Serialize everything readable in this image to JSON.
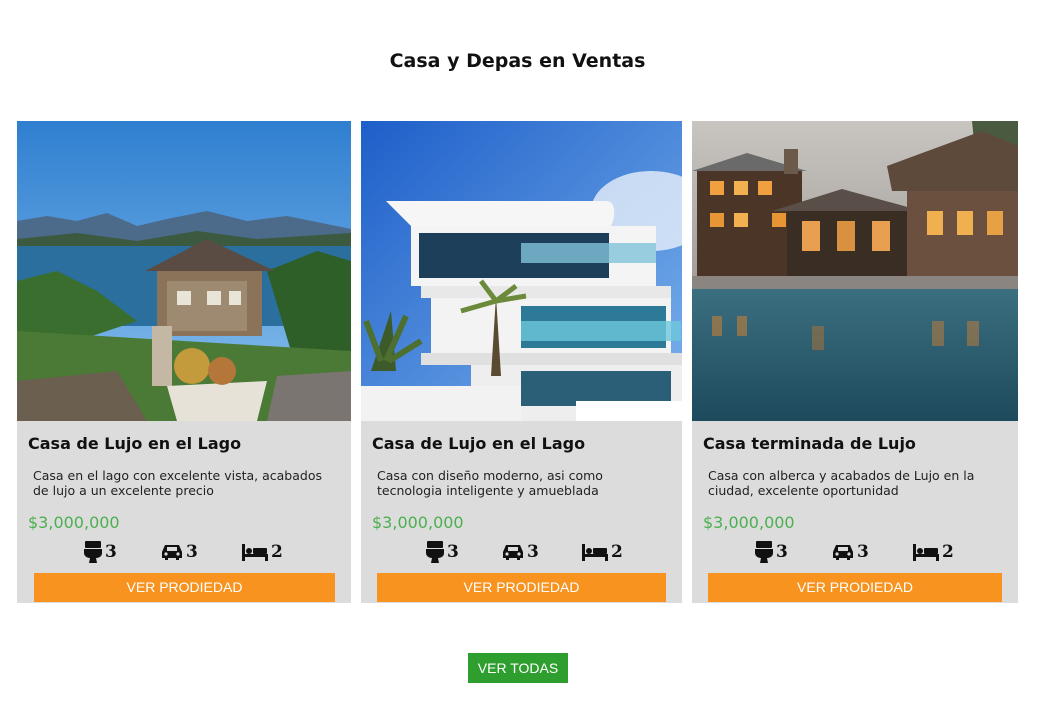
{
  "section": {
    "title": "Casa y Depas en Ventas"
  },
  "properties": [
    {
      "title": "Casa de Lujo en el Lago",
      "description": "Casa en el lago con excelente vista, acabados de lujo a un excelente precio",
      "price": "$3,000,000",
      "bathrooms": "3",
      "parking": "3",
      "bedrooms": "2",
      "button": "VER PRODIEDAD",
      "photo": "lake-house-photo"
    },
    {
      "title": "Casa de Lujo en el Lago",
      "description": "Casa con diseño moderno, asi como tecnologia inteligente y amueblada",
      "price": "$3,000,000",
      "bathrooms": "3",
      "parking": "3",
      "bedrooms": "2",
      "button": "VER PRODIEDAD",
      "photo": "modern-house-photo"
    },
    {
      "title": "Casa terminada de Lujo",
      "description": "Casa con alberca y acabados de Lujo en la ciudad, excelente oportunidad",
      "price": "$3,000,000",
      "bathrooms": "3",
      "parking": "3",
      "bedrooms": "2",
      "button": "VER PRODIEDAD",
      "photo": "pool-house-photo"
    }
  ],
  "view_all": "VER TODAS",
  "colors": {
    "card_bg": "#dcdcdc",
    "price": "#4caf50",
    "button_orange": "#f7931e",
    "button_green": "#2e9e2e"
  },
  "icons": [
    "toilet-icon",
    "car-icon",
    "bed-icon"
  ]
}
